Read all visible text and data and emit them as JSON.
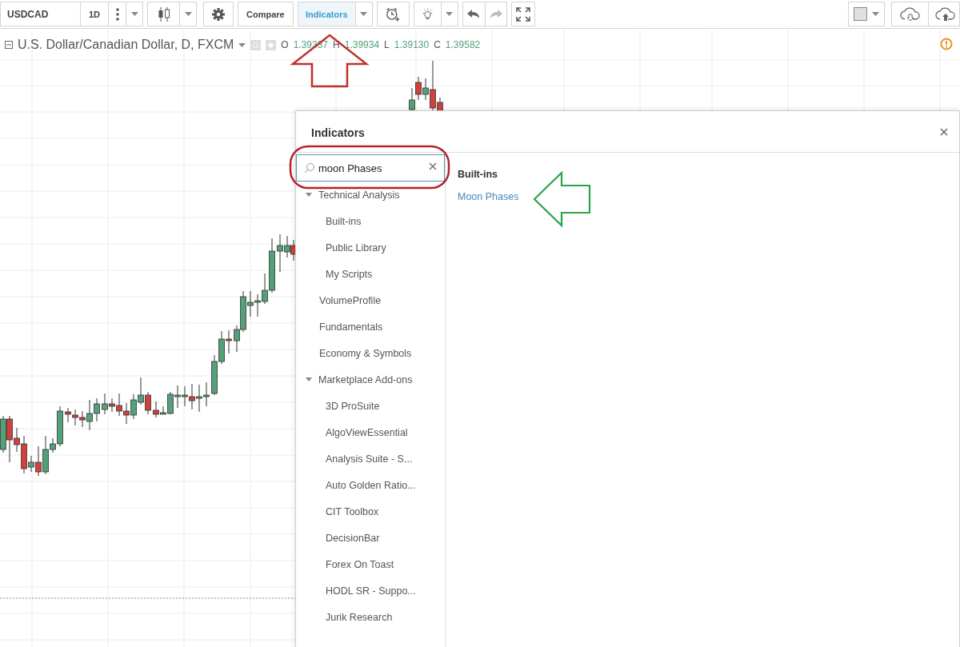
{
  "toolbar": {
    "symbol": "USDCAD",
    "interval": "1D",
    "compare": "Compare",
    "indicators": {
      "label": "Indicators",
      "selected": true
    }
  },
  "legend": {
    "title": "U.S. Dollar/Canadian Dollar, D, FXCM",
    "values": [
      {
        "label": "O",
        "value": "1.39337"
      },
      {
        "label": "H",
        "value": "1.39934"
      },
      {
        "label": "L",
        "value": "1.39130"
      },
      {
        "label": "C",
        "value": "1.39582"
      }
    ]
  },
  "dialog": {
    "title": "Indicators",
    "search": {
      "value": "moon Phases"
    },
    "categories": [
      {
        "label": "Technical Analysis",
        "expanded": true,
        "children": [
          {
            "label": "Built-ins"
          },
          {
            "label": "Public Library"
          },
          {
            "label": "My Scripts"
          }
        ]
      },
      {
        "label": "VolumeProfile"
      },
      {
        "label": "Fundamentals"
      },
      {
        "label": "Economy & Symbols"
      },
      {
        "label": "Marketplace Add-ons",
        "expanded": true,
        "children": [
          {
            "label": "3D ProSuite"
          },
          {
            "label": "AlgoViewEssential"
          },
          {
            "label": "Analysis Suite - S..."
          },
          {
            "label": "Auto Golden Ratio..."
          },
          {
            "label": "CIT Toolbox"
          },
          {
            "label": "DecisionBar"
          },
          {
            "label": "Forex On Toast"
          },
          {
            "label": "HODL SR - Suppo..."
          },
          {
            "label": "Jurik Research"
          }
        ]
      }
    ],
    "results": {
      "heading": "Built-ins",
      "items": [
        "Moon Phases"
      ]
    }
  }
}
